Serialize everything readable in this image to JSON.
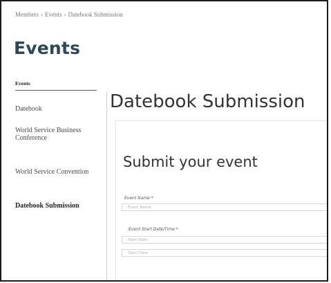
{
  "breadcrumb": {
    "items": [
      "Members",
      "Events",
      "Datebook Submission"
    ],
    "separator": "›"
  },
  "section_title": "Events",
  "sidebar": {
    "heading": "Events",
    "items": [
      {
        "label": "Datebook",
        "active": false
      },
      {
        "label": "World Service Business Conference",
        "active": false
      },
      {
        "label": "World Service Convention",
        "active": false
      },
      {
        "label": "Datebook Submission",
        "active": true
      }
    ]
  },
  "main": {
    "title": "Datebook Submission",
    "form": {
      "title": "Submit your event",
      "event_name_label": "Event Name *",
      "event_name_placeholder": "Event Name",
      "start_label": "Event Start Date/Time *",
      "start_date_placeholder": "Start Date",
      "start_time_placeholder": "Start Time"
    }
  },
  "colors": {
    "section_title": "#2f4858",
    "frame_border": "#1a1a1a"
  }
}
